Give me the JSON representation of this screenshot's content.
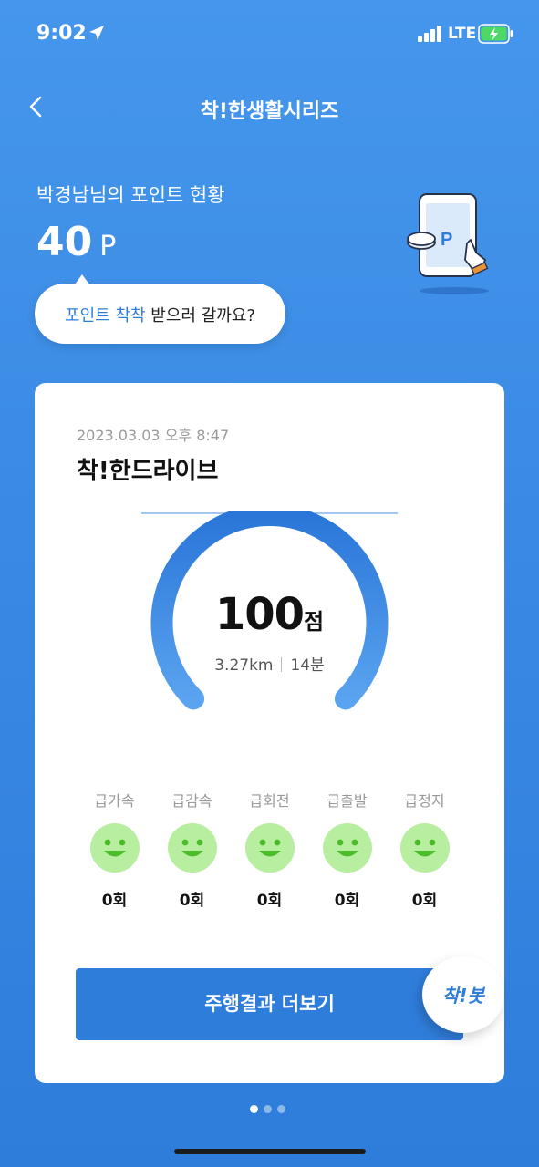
{
  "status_bar": {
    "time": "9:02",
    "network": "LTE",
    "location_icon": "location-arrow-icon",
    "signal_icon": "signal-bars-icon",
    "battery_icon": "battery-charging-icon"
  },
  "nav": {
    "title": "착!한생활시리즈",
    "back_icon": "chevron-left-icon"
  },
  "points": {
    "title": "박경남님의 포인트 현황",
    "value": "40",
    "unit": "P",
    "illustration_icon": "phone-point-icon",
    "illustration_letter": "P"
  },
  "cta": {
    "highlight": "포인트 착착",
    "rest": " 받으러 갈까요?"
  },
  "card": {
    "date": "2023.03.03 오후 8:47",
    "title": "착!한드라이브",
    "score": "100",
    "score_unit": "점",
    "score_fraction": 1.0,
    "distance": "3.27km",
    "duration": "14분",
    "stats": [
      {
        "label": "급가속",
        "count": "0회",
        "icon": "smile-icon"
      },
      {
        "label": "급감속",
        "count": "0회",
        "icon": "smile-icon"
      },
      {
        "label": "급회전",
        "count": "0회",
        "icon": "smile-icon"
      },
      {
        "label": "급출발",
        "count": "0회",
        "icon": "smile-icon"
      },
      {
        "label": "급정지",
        "count": "0회",
        "icon": "smile-icon"
      }
    ],
    "more_button": "주행결과 더보기",
    "bot_label": "착!봇"
  },
  "pager": {
    "count": 3,
    "active": 0
  },
  "colors": {
    "accent": "#2f7ddb",
    "background": "#3a8ae4",
    "smile": "#b8eea0",
    "smile_face": "#4cbd2a"
  }
}
